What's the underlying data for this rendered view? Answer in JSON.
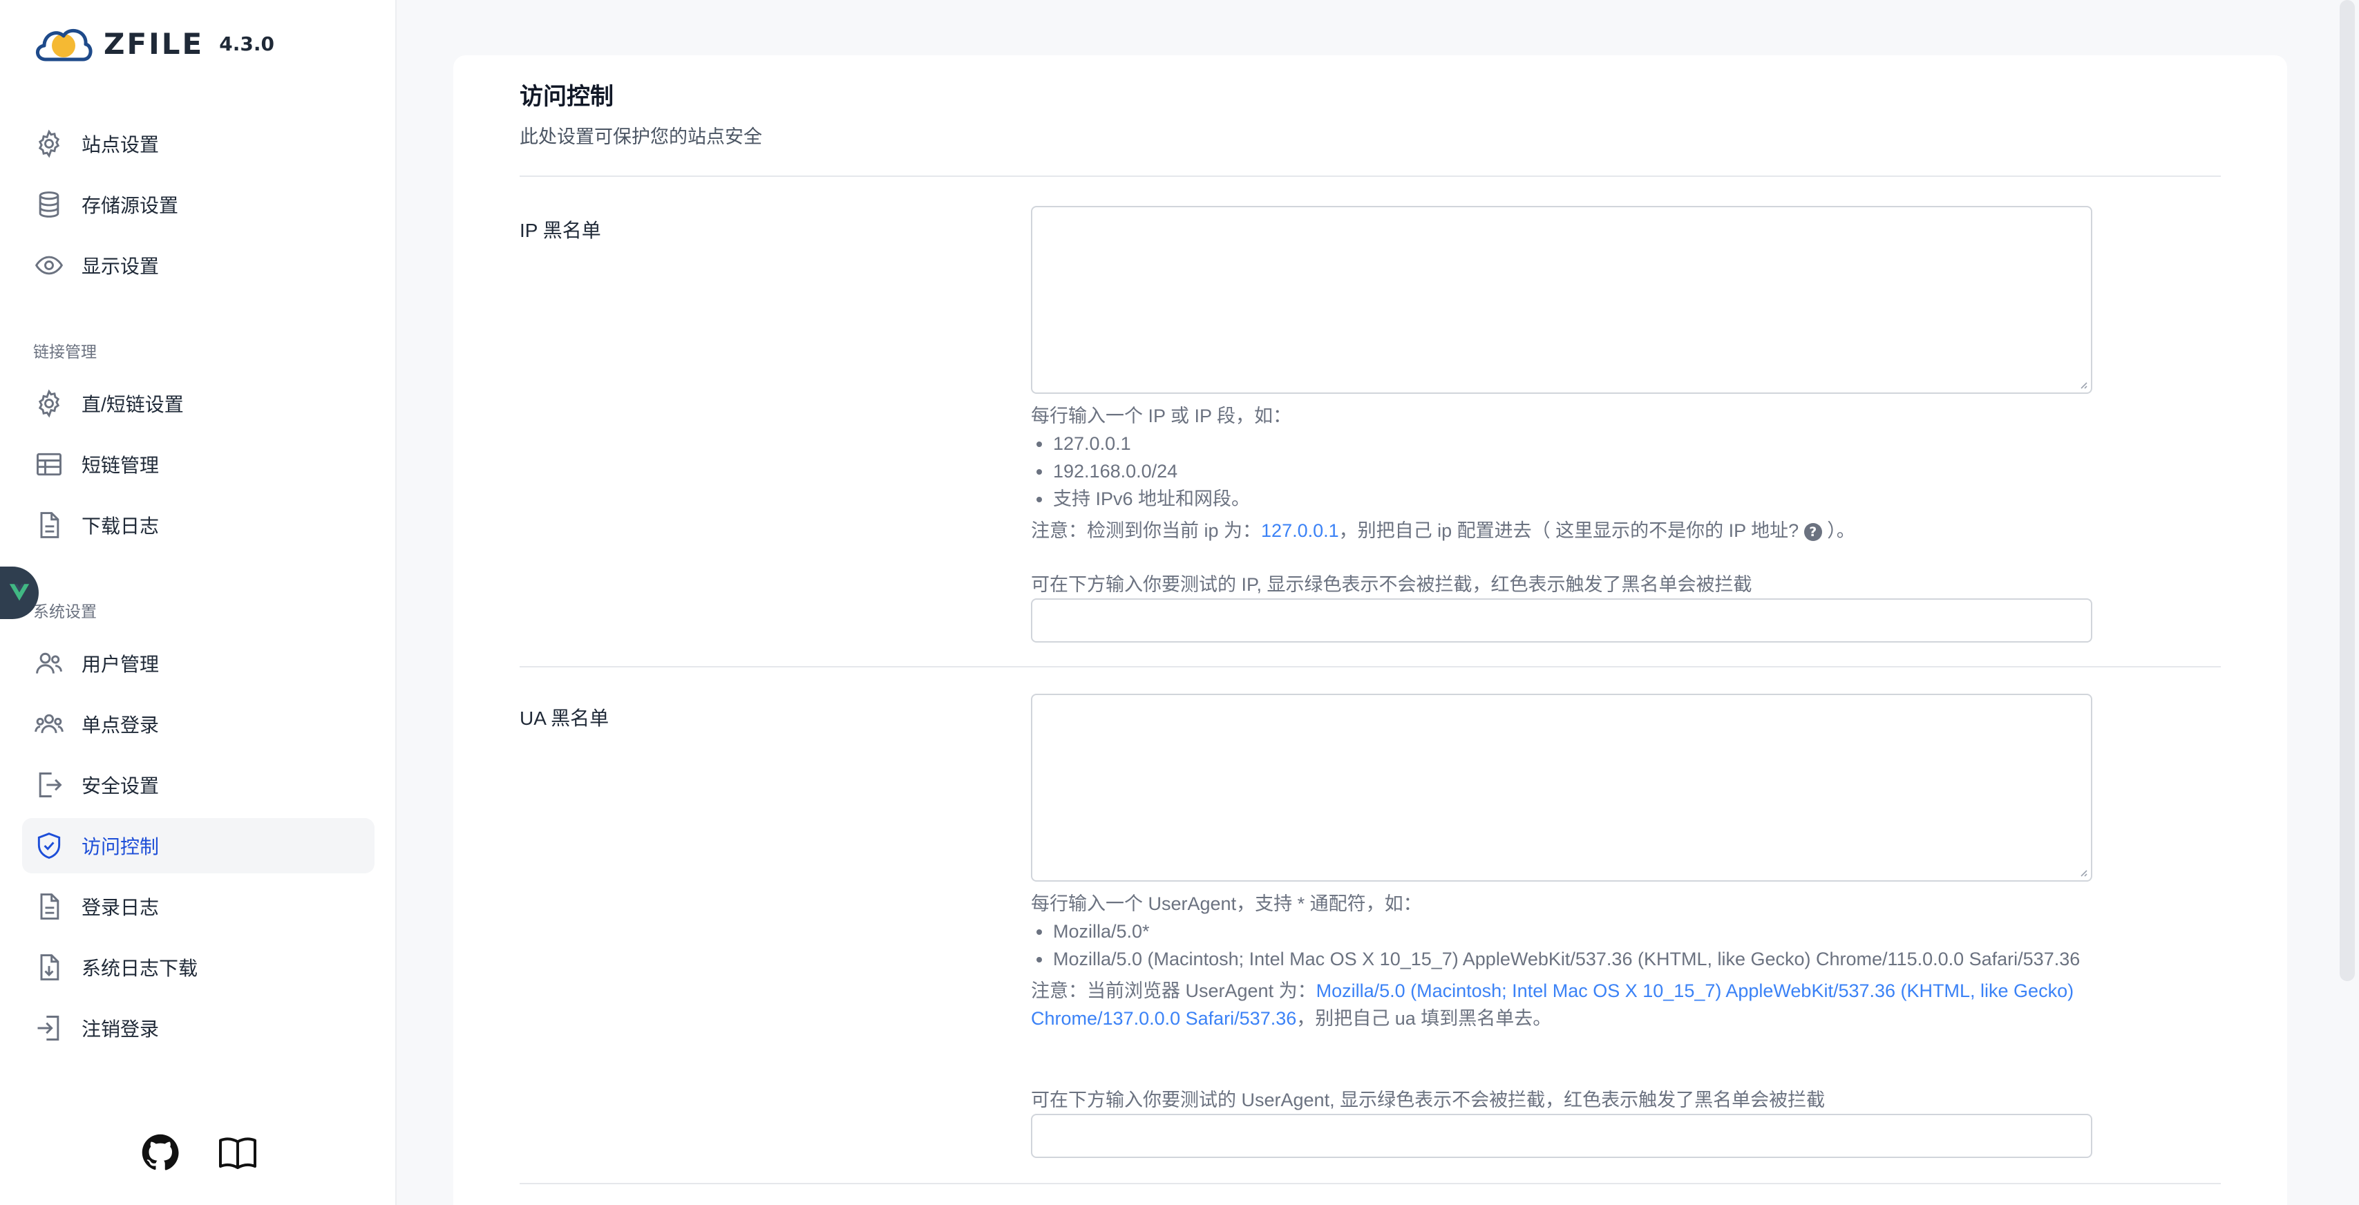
{
  "app": {
    "name": "ZFILE",
    "version": "4.3.0"
  },
  "sidebar": {
    "group1": [
      {
        "label": "站点设置",
        "icon": "gear-icon"
      },
      {
        "label": "存储源设置",
        "icon": "database-icon"
      },
      {
        "label": "显示设置",
        "icon": "eye-icon"
      }
    ],
    "section_link": "链接管理",
    "group2": [
      {
        "label": "直/短链设置",
        "icon": "gear-icon"
      },
      {
        "label": "短链管理",
        "icon": "table-icon"
      },
      {
        "label": "下载日志",
        "icon": "document-icon"
      }
    ],
    "section_system": "系统设置",
    "group3": [
      {
        "label": "用户管理",
        "icon": "users-icon"
      },
      {
        "label": "单点登录",
        "icon": "user-group-icon"
      },
      {
        "label": "安全设置",
        "icon": "logout-icon"
      },
      {
        "label": "访问控制",
        "icon": "shield-check-icon",
        "active": true
      },
      {
        "label": "登录日志",
        "icon": "document-icon"
      },
      {
        "label": "系统日志下载",
        "icon": "document-download-icon"
      },
      {
        "label": "注销登录",
        "icon": "login-icon"
      }
    ]
  },
  "page": {
    "title": "访问控制",
    "subtitle": "此处设置可保护您的站点安全",
    "ip": {
      "label": "IP 黑名单",
      "value": "",
      "help_intro": "每行输入一个 IP 或 IP 段，如：",
      "examples": [
        "127.0.0.1",
        "192.168.0.0/24",
        "支持 IPv6 地址和网段。"
      ],
      "note_prefix": "注意：检测到你当前 ip 为：",
      "current_ip": "127.0.0.1",
      "note_suffix": "，别把自己 ip 配置进去（ 这里显示的不是你的 IP 地址? ",
      "note_end": " ）。",
      "qmark": "?",
      "test_hint": "可在下方输入你要测试的 IP, 显示绿色表示不会被拦截，红色表示触发了黑名单会被拦截",
      "test_value": ""
    },
    "ua": {
      "label": "UA 黑名单",
      "value": "",
      "help_intro": "每行输入一个 UserAgent，支持 * 通配符，如：",
      "examples": [
        "Mozilla/5.0*",
        "Mozilla/5.0 (Macintosh; Intel Mac OS X 10_15_7) AppleWebKit/537.36 (KHTML, like Gecko) Chrome/115.0.0.0 Safari/537.36"
      ],
      "note_prefix": "注意：当前浏览器 UserAgent 为：",
      "current_ua": "Mozilla/5.0 (Macintosh; Intel Mac OS X 10_15_7) AppleWebKit/537.36 (KHTML, like Gecko) Chrome/137.0.0.0 Safari/537.36",
      "note_suffix": "，别把自己 ua 填到黑名单去。",
      "test_hint": "可在下方输入你要测试的 UserAgent, 显示绿色表示不会被拦截，红色表示触发了黑名单会被拦截",
      "test_value": ""
    }
  }
}
